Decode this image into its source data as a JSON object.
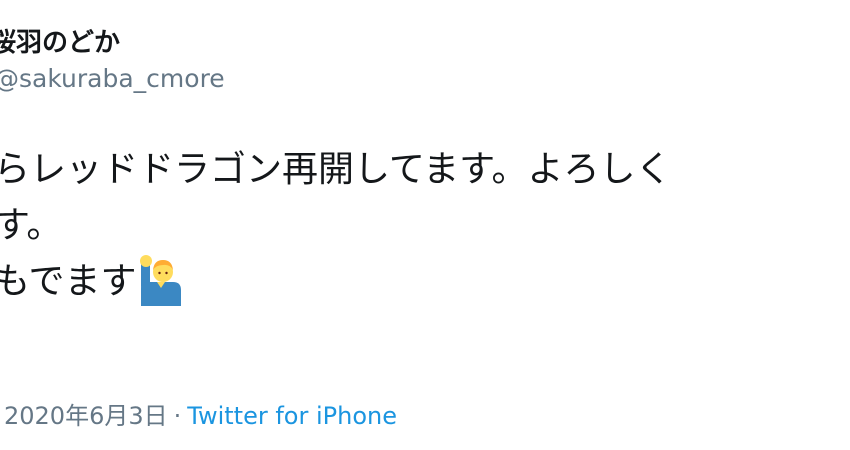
{
  "author": {
    "display_name": "桜羽のどか",
    "handle": "@sakuraba_cmore"
  },
  "tweet": {
    "lines": [
      "らレッドドラゴン再開してます。よろしく",
      "す。",
      "もでます"
    ],
    "emoji": "person-raising-hand-icon"
  },
  "meta": {
    "date": "2020年6月3日",
    "separator": "·",
    "source": "Twitter for iPhone"
  },
  "colors": {
    "text": "#14171a",
    "secondary": "#657786",
    "link": "#1b95e0"
  }
}
